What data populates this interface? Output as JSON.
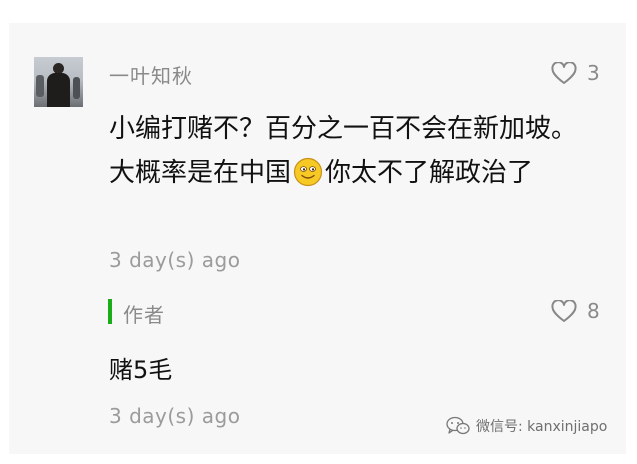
{
  "comment": {
    "username": "一叶知秋",
    "like_count": "3",
    "text_part1": "小编打赌不？百分之一百不会在新加坡。大概率是在中国",
    "text_part2": "你太不了解政治了",
    "emoji_icon": "smiling-face-emoji",
    "time": "3 day(s) ago"
  },
  "reply": {
    "author_label": "作者",
    "like_count": "8",
    "text": "赌5毛",
    "time": "3 day(s) ago"
  },
  "watermark": {
    "text": "微信号: kanxinjiapo",
    "icon": "wechat-icon"
  },
  "colors": {
    "background": "#f7f7f7",
    "author_accent": "#1aad19",
    "meta_text": "#8a8a8a"
  }
}
